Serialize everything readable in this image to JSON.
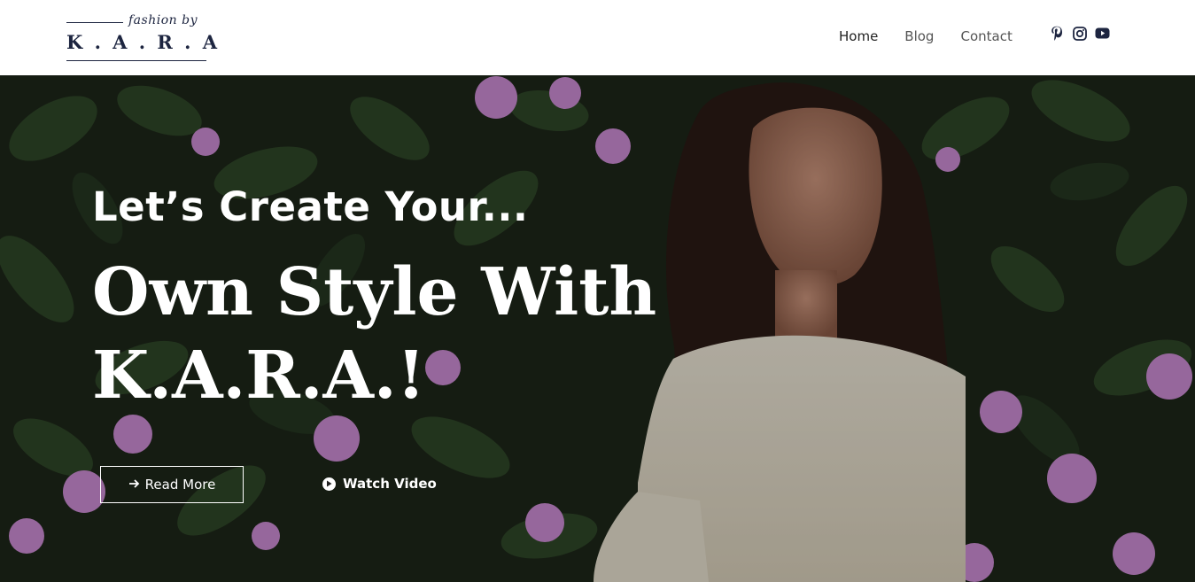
{
  "logo": {
    "script": "fashion by",
    "word": "K . A . R . A"
  },
  "nav": {
    "items": [
      "Home",
      "Blog",
      "Contact"
    ]
  },
  "socials": [
    {
      "icon": "pinterest-icon"
    },
    {
      "icon": "instagram-icon"
    },
    {
      "icon": "youtube-icon"
    }
  ],
  "hero": {
    "subtitle": "Let’s Create Your...",
    "title_line1": "Own Style With",
    "title_line2": "K.A.R.A.!",
    "read_more": "Read More",
    "watch_video": "Watch Video"
  },
  "colors": {
    "brand": "#1d2540",
    "hero_text": "#ffffff",
    "flower": "#c98ad0",
    "foliage": "#2d3f26"
  }
}
